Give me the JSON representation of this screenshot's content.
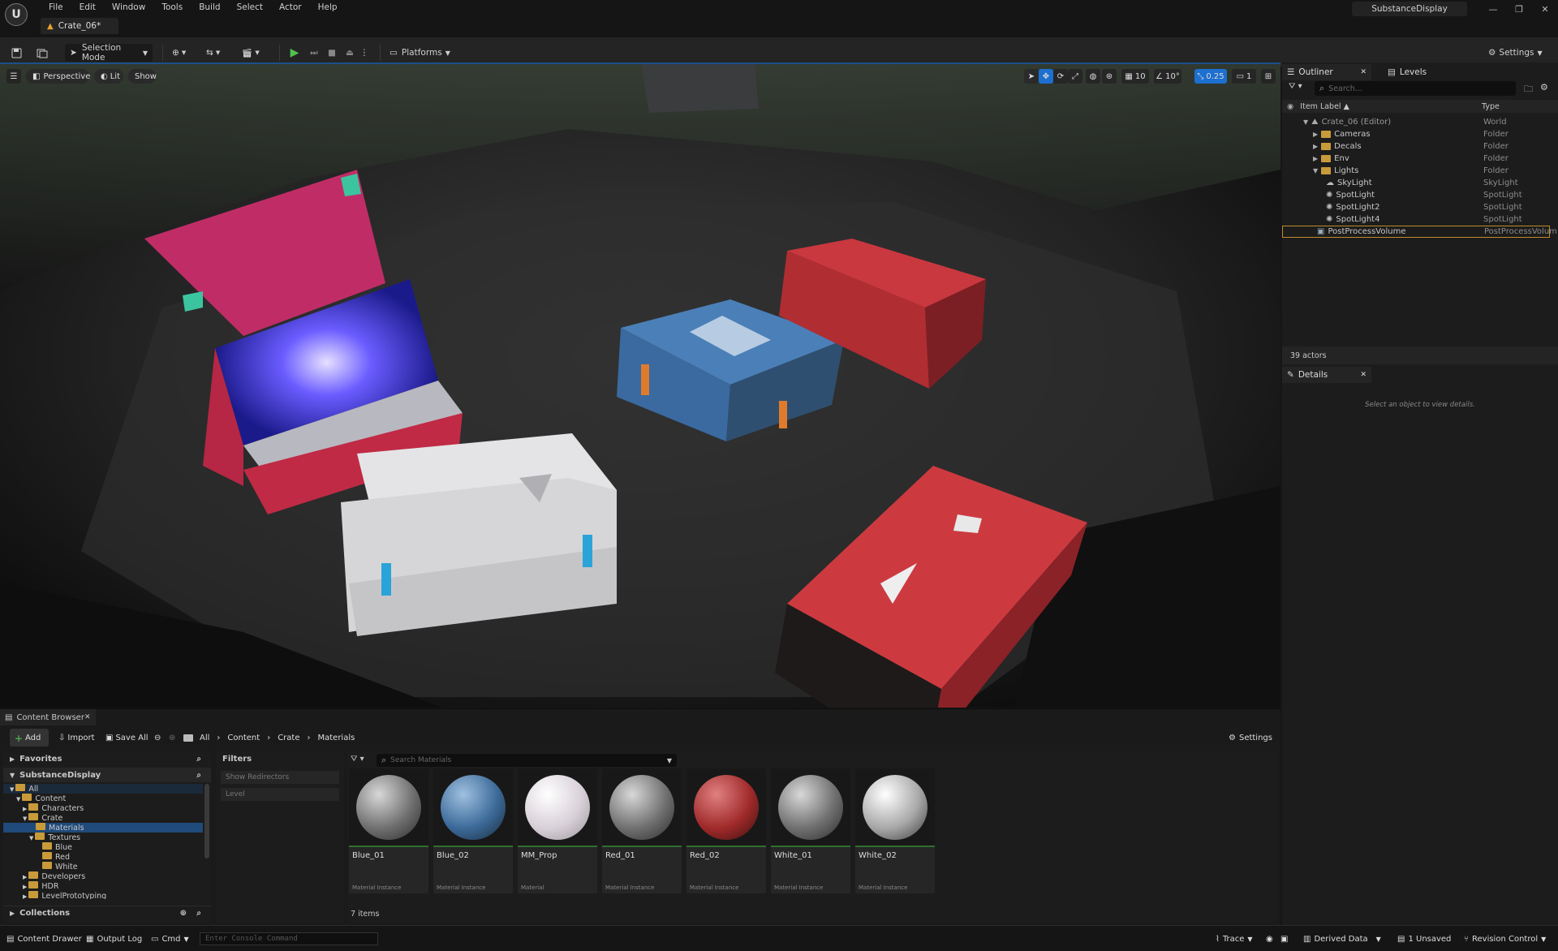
{
  "menubar": {
    "items": [
      "File",
      "Edit",
      "Window",
      "Tools",
      "Build",
      "Select",
      "Actor",
      "Help"
    ],
    "doc_tab": "Crate_06*",
    "project_name": "SubstanceDisplay"
  },
  "toolbar": {
    "selection_mode": "Selection Mode",
    "platforms": "Platforms",
    "settings": "Settings"
  },
  "viewport": {
    "perspective": "Perspective",
    "lit": "Lit",
    "show": "Show",
    "grid_snap": "10",
    "rot_snap": "10°",
    "scale_snap": "0.25",
    "cam_speed": "1"
  },
  "outliner": {
    "tab": "Outliner",
    "levels_tab": "Levels",
    "search_placeholder": "Search...",
    "col_label": "Item Label ▲",
    "col_type": "Type",
    "rows": [
      {
        "label": "Crate_06 (Editor)",
        "type": "World"
      },
      {
        "label": "Cameras",
        "type": "Folder"
      },
      {
        "label": "Decals",
        "type": "Folder"
      },
      {
        "label": "Env",
        "type": "Folder"
      },
      {
        "label": "Lights",
        "type": "Folder"
      },
      {
        "label": "SkyLight",
        "type": "SkyLight"
      },
      {
        "label": "SpotLight",
        "type": "SpotLight"
      },
      {
        "label": "SpotLight2",
        "type": "SpotLight"
      },
      {
        "label": "SpotLight4",
        "type": "SpotLight"
      },
      {
        "label": "PostProcessVolume",
        "type": "PostProcessVolum"
      }
    ],
    "actor_count": "39 actors"
  },
  "details": {
    "tab": "Details",
    "empty_msg": "Select an object to view details."
  },
  "content_browser": {
    "tab": "Content Browser",
    "add": "Add",
    "import": "Import",
    "save_all": "Save All",
    "path": [
      "All",
      "Content",
      "Crate",
      "Materials"
    ],
    "settings": "Settings",
    "favorites": "Favorites",
    "project": "SubstanceDisplay",
    "collections": "Collections",
    "filters_title": "Filters",
    "filter_items": [
      "Show Redirectors",
      "Level"
    ],
    "search_placeholder": "Search Materials",
    "tree": [
      "All",
      "Content",
      "Characters",
      "Crate",
      "Materials",
      "Textures",
      "Blue",
      "Red",
      "White",
      "Developers",
      "HDR",
      "LevelPrototyping"
    ],
    "assets": [
      {
        "name": "Blue_01",
        "kind": "Material Instance"
      },
      {
        "name": "Blue_02",
        "kind": "Material Instance"
      },
      {
        "name": "MM_Prop",
        "kind": "Material"
      },
      {
        "name": "Red_01",
        "kind": "Material Instance"
      },
      {
        "name": "Red_02",
        "kind": "Material Instance"
      },
      {
        "name": "White_01",
        "kind": "Material Instance"
      },
      {
        "name": "White_02",
        "kind": "Material Instance"
      }
    ],
    "item_count": "7 items"
  },
  "statusbar": {
    "content_drawer": "Content Drawer",
    "output_log": "Output Log",
    "cmd": "Cmd",
    "console_placeholder": "Enter Console Command",
    "trace": "Trace",
    "derived_data": "Derived Data",
    "unsaved": "1 Unsaved",
    "revision_control": "Revision Control"
  },
  "colors": {
    "accent": "#1d6fd0",
    "folder": "#c99a3a",
    "selection": "#1f4a7a"
  }
}
